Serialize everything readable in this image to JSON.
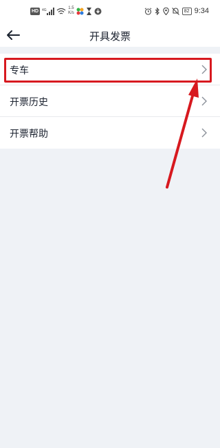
{
  "status_bar": {
    "hd": "HD",
    "net_type": "4G",
    "speed_value": "1.5",
    "speed_unit": "K/s",
    "battery": "82",
    "time": "9:34"
  },
  "header": {
    "title": "开具发票"
  },
  "menu": {
    "items": [
      {
        "label": "专车"
      },
      {
        "label": "开票历史"
      },
      {
        "label": "开票帮助"
      }
    ]
  },
  "annotation": {
    "color": "#d7191f"
  },
  "colors": {
    "background": "#eff2f6",
    "surface": "#ffffff",
    "text": "#1c2330",
    "chevron": "#8a9099"
  }
}
